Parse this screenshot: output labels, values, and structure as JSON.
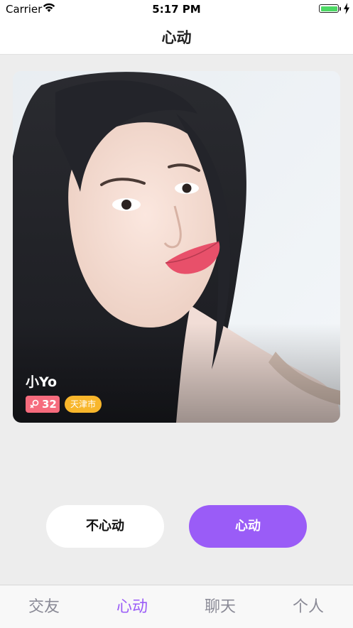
{
  "status_bar": {
    "carrier": "Carrier",
    "time": "5:17 PM",
    "battery_level": 1.0,
    "battery_color": "#4cd964"
  },
  "nav": {
    "title": "心动"
  },
  "profile": {
    "name": "小Yo",
    "age": "32",
    "city": "天津市",
    "gender_icon": "female-icon",
    "age_badge_color": "#f66b7d",
    "city_badge_color": "#f8b62b"
  },
  "actions": {
    "dislike_label": "不心动",
    "like_label": "心动",
    "like_color": "#9a5cf7"
  },
  "tabs": [
    {
      "label": "交友",
      "active": false
    },
    {
      "label": "心动",
      "active": true
    },
    {
      "label": "聊天",
      "active": false
    },
    {
      "label": "个人",
      "active": false
    }
  ],
  "colors": {
    "accent": "#9a5cf7",
    "background": "#ededed"
  }
}
